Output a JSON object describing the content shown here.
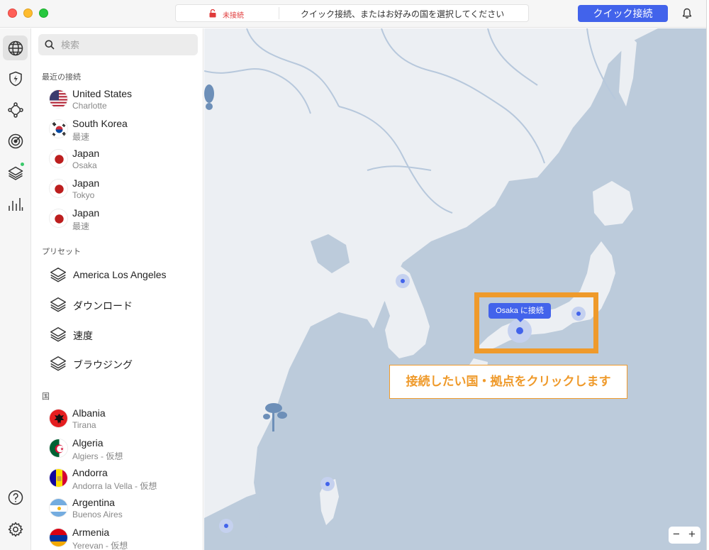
{
  "titlebar": {
    "status": "未接続",
    "hint": "クイック接続、またはお好みの国を選択してください",
    "quick_connect": "クイック接続"
  },
  "rail": {
    "icons": [
      "globe-icon",
      "shield-bolt-icon",
      "meshnet-icon",
      "target-icon",
      "layers-icon",
      "stats-icon",
      "help-icon",
      "gear-icon"
    ]
  },
  "search": {
    "placeholder": "検索"
  },
  "recent": {
    "label": "最近の接続",
    "items": [
      {
        "title": "United States",
        "sub": "Charlotte",
        "flag": "us"
      },
      {
        "title": "South Korea",
        "sub": "最速",
        "flag": "kr"
      },
      {
        "title": "Japan",
        "sub": "Osaka",
        "flag": "jp"
      },
      {
        "title": "Japan",
        "sub": "Tokyo",
        "flag": "jp"
      },
      {
        "title": "Japan",
        "sub": "最速",
        "flag": "jp"
      }
    ]
  },
  "presets": {
    "label": "プリセット",
    "items": [
      "America Los Angeles",
      "ダウンロード",
      "速度",
      "ブラウジング"
    ]
  },
  "countries": {
    "label": "国",
    "items": [
      {
        "title": "Albania",
        "sub": "Tirana",
        "flag": "al"
      },
      {
        "title": "Algeria",
        "sub": "Algiers - 仮想",
        "flag": "dz"
      },
      {
        "title": "Andorra",
        "sub": "Andorra la Vella - 仮想",
        "flag": "ad"
      },
      {
        "title": "Argentina",
        "sub": "Buenos Aires",
        "flag": "ar"
      },
      {
        "title": "Armenia",
        "sub": "Yerevan - 仮想",
        "flag": "am"
      }
    ]
  },
  "map": {
    "tooltip": "Osaka に接続",
    "callout": "接続したい国・拠点をクリックします",
    "zoom_out": "−",
    "zoom_in": "+"
  },
  "colors": {
    "accent": "#4263eb",
    "sea": "#bccbdb",
    "land": "#eceff3",
    "annotation": "#ef9a2b",
    "disconnected": "#e03b3b"
  }
}
